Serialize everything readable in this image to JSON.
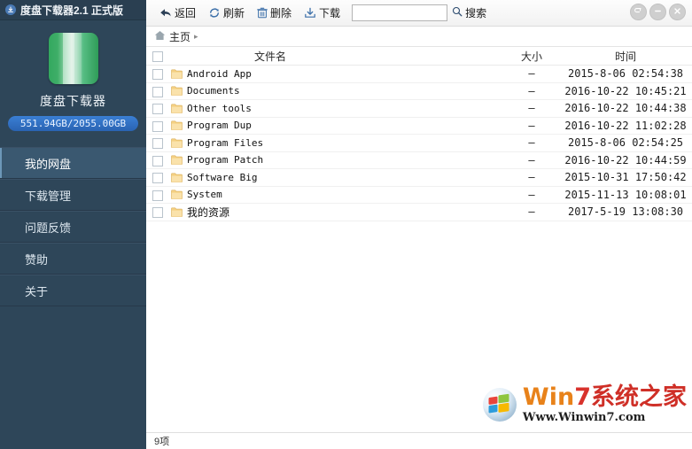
{
  "window": {
    "title": "度盘下载器2.1 正式版",
    "title_icon": "download-circle-icon",
    "controls": [
      {
        "name": "restore-button",
        "glyph": "↪"
      },
      {
        "name": "minimize-button",
        "glyph": "–"
      },
      {
        "name": "close-button",
        "glyph": "✕"
      }
    ]
  },
  "sidebar": {
    "app_name": "度盘下载器",
    "quota": "551.94GB/2055.00GB",
    "items": [
      {
        "label": "我的网盘",
        "active": true
      },
      {
        "label": "下载管理",
        "active": false
      },
      {
        "label": "问题反馈",
        "active": false
      },
      {
        "label": "赞助",
        "active": false
      },
      {
        "label": "关于",
        "active": false
      }
    ]
  },
  "toolbar": {
    "back_label": "返回",
    "refresh_label": "刷新",
    "delete_label": "删除",
    "download_label": "下载",
    "search_value": "",
    "search_placeholder": "",
    "search_label": "搜索"
  },
  "breadcrumb": {
    "home_label": "主页",
    "separator": "▸"
  },
  "table": {
    "headers": {
      "name": "文件名",
      "size": "大小",
      "time": "时间"
    },
    "rows": [
      {
        "name": "Android App",
        "size": "–",
        "time": "2015-8-06 02:54:38",
        "cjk": false
      },
      {
        "name": "Documents",
        "size": "–",
        "time": "2016-10-22 10:45:21",
        "cjk": false
      },
      {
        "name": "Other tools",
        "size": "–",
        "time": "2016-10-22 10:44:38",
        "cjk": false
      },
      {
        "name": "Program Dup",
        "size": "–",
        "time": "2016-10-22 11:02:28",
        "cjk": false
      },
      {
        "name": "Program Files",
        "size": "–",
        "time": "2015-8-06 02:54:25",
        "cjk": false
      },
      {
        "name": "Program Patch",
        "size": "–",
        "time": "2016-10-22 10:44:59",
        "cjk": false
      },
      {
        "name": "Software Big",
        "size": "–",
        "time": "2015-10-31 17:50:42",
        "cjk": false
      },
      {
        "name": "System",
        "size": "–",
        "time": "2015-11-13 10:08:01",
        "cjk": false
      },
      {
        "name": "我的资源",
        "size": "–",
        "time": "2017-5-19 13:08:30",
        "cjk": true
      }
    ]
  },
  "statusbar": {
    "count_text": "9项"
  },
  "watermark": {
    "word_w": "W",
    "word_in": "in",
    "word_7": "7",
    "word_cn": "系统之家",
    "url": "Www.Winwin7.com"
  },
  "colors": {
    "sidebar_bg": "#2e4659",
    "sidebar_active": "#3a5870",
    "quota_badge": "#2f6fc4",
    "logo_green": "#33a85f",
    "folder_yellow": "#f3cd7d",
    "accent_orange": "#e8821a",
    "accent_red": "#d8322c"
  }
}
